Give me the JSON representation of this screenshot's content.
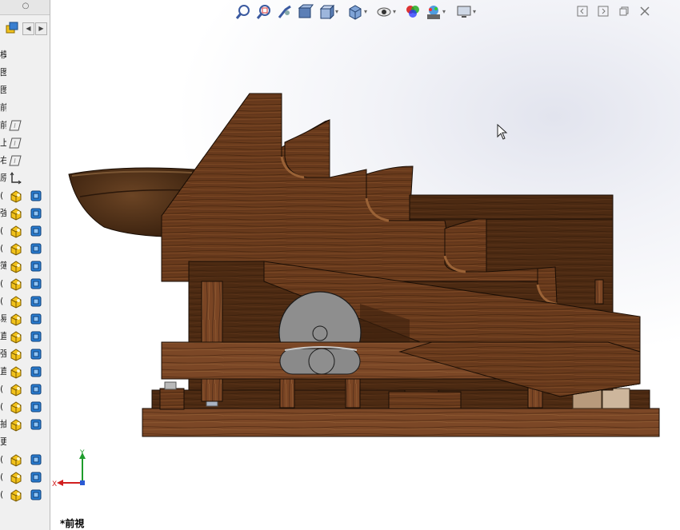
{
  "left_panel": {
    "minimize_glyph": "○",
    "tabs": {
      "prev_glyph": "◀",
      "next_glyph": "▶"
    },
    "row_prefixes": [
      "模",
      "图",
      "图",
      "前",
      "前",
      "上",
      "右",
      "原",
      "(",
      "強",
      "(",
      "(",
      "簿",
      "(",
      "(",
      "易",
      "直",
      "强",
      "直",
      "(",
      "(",
      "抽",
      "更",
      "(",
      "(",
      "("
    ],
    "rows": [
      {
        "prefix_index": 0,
        "icons": []
      },
      {
        "prefix_index": 1,
        "icons": []
      },
      {
        "prefix_index": 2,
        "icons": []
      },
      {
        "prefix_index": 3,
        "icons": []
      },
      {
        "prefix_index": 4,
        "icons": [
          "plane-icon"
        ]
      },
      {
        "prefix_index": 5,
        "icons": [
          "plane-icon"
        ]
      },
      {
        "prefix_index": 6,
        "icons": [
          "plane-icon"
        ]
      },
      {
        "prefix_index": 7,
        "icons": [
          "origin-icon"
        ]
      },
      {
        "prefix_index": 8,
        "icons": [
          "part-icon",
          "body-icon"
        ]
      },
      {
        "prefix_index": 9,
        "icons": [
          "part-icon",
          "body-icon"
        ]
      },
      {
        "prefix_index": 10,
        "icons": [
          "part-icon",
          "body-icon"
        ]
      },
      {
        "prefix_index": 11,
        "icons": [
          "part-icon",
          "body-icon"
        ]
      },
      {
        "prefix_index": 12,
        "icons": [
          "part-icon",
          "body-icon"
        ]
      },
      {
        "prefix_index": 13,
        "icons": [
          "part-icon",
          "body-icon"
        ]
      },
      {
        "prefix_index": 14,
        "icons": [
          "part-icon",
          "body-icon"
        ]
      },
      {
        "prefix_index": 15,
        "icons": [
          "part-icon",
          "body-icon"
        ]
      },
      {
        "prefix_index": 16,
        "icons": [
          "part-icon",
          "body-icon"
        ]
      },
      {
        "prefix_index": 17,
        "icons": [
          "part-icon",
          "body-icon"
        ]
      },
      {
        "prefix_index": 18,
        "icons": [
          "part-icon",
          "body-icon"
        ]
      },
      {
        "prefix_index": 19,
        "icons": [
          "part-icon",
          "body-icon"
        ]
      },
      {
        "prefix_index": 20,
        "icons": [
          "part-icon",
          "body-icon"
        ]
      },
      {
        "prefix_index": 21,
        "icons": [
          "part-icon",
          "body-icon"
        ]
      },
      {
        "prefix_index": 22,
        "icons": []
      },
      {
        "prefix_index": 23,
        "icons": [
          "part-icon",
          "body-icon"
        ]
      },
      {
        "prefix_index": 24,
        "icons": [
          "part-icon",
          "body-icon"
        ]
      },
      {
        "prefix_index": 25,
        "icons": [
          "part-icon",
          "body-icon"
        ]
      }
    ]
  },
  "viewport": {
    "view_name": "*前視",
    "toolbar_icons": [
      "zoom-to-fit-icon",
      "zoom-to-area-icon",
      "previous-view-icon",
      "section-view-icon",
      "view-orientation-icon",
      "display-style-icon",
      "hide-show-items-icon",
      "edit-appearance-icon",
      "apply-scene-icon",
      "view-settings-icon"
    ],
    "window_controls": [
      "tile-left-icon",
      "tile-right-icon",
      "restore-icon",
      "close-icon"
    ],
    "triad": {
      "x_label": "X",
      "y_label": "Y"
    }
  },
  "colors": {
    "wood_dark": "#5a3216",
    "wood_mid": "#6e3f1f",
    "wood_light": "#7d4a27",
    "wheel_gray": "#8e8e8e",
    "axis_x": "#d11f1f",
    "axis_y": "#1e9c2c",
    "part_icon_yellow": "#f2c21b",
    "body_icon_blue": "#2a7fd4"
  }
}
